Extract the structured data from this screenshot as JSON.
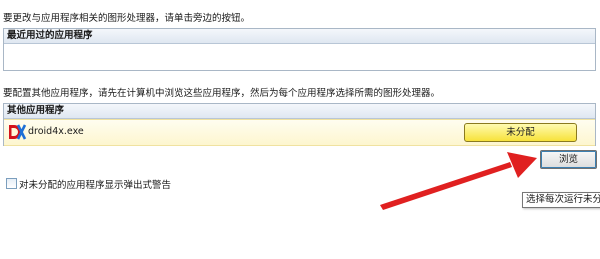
{
  "instructions": {
    "top": "要更改与应用程序相关的图形处理器，请单击旁边的按钮。",
    "middle": "要配置其他应用程序，请先在计算机中浏览这些应用程序，然后为每个应用程序选择所需的图形处理器。"
  },
  "recent_apps": {
    "header": "最近用过的应用程序"
  },
  "other_apps": {
    "header": "其他应用程序",
    "items": [
      {
        "name": "droid4x.exe",
        "icon": "droid4x-app-icon",
        "assignment": "未分配"
      }
    ]
  },
  "browse_button": {
    "label": "浏览"
  },
  "warning_option": {
    "label": "对未分配的应用程序显示弹出式警告",
    "checked": false
  },
  "tooltip": {
    "text": "选择每次运行未分"
  },
  "colors": {
    "arrow": "#e02020",
    "assign_button": "#f7e23a",
    "row_highlight": "#fdf6cf"
  }
}
